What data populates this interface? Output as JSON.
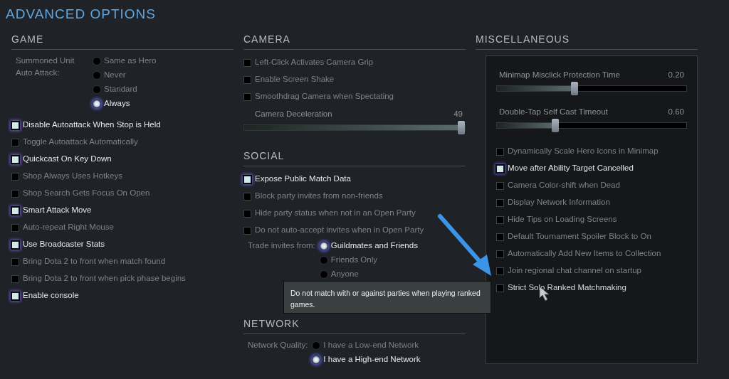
{
  "title": "ADVANCED OPTIONS",
  "columns": [
    {
      "sections": [
        {
          "heading": "GAME",
          "boxed": false,
          "items": [
            {
              "kind": "radio_group",
              "label": "Summoned Unit Auto Attack:",
              "options": [
                {
                  "label": "Same as Hero",
                  "selected": false
                },
                {
                  "label": "Never",
                  "selected": false
                },
                {
                  "label": "Standard",
                  "selected": false
                },
                {
                  "label": "Always",
                  "selected": true
                }
              ]
            },
            {
              "kind": "checkbox",
              "label": "Disable Autoattack When Stop is Held",
              "checked": true
            },
            {
              "kind": "checkbox",
              "label": "Toggle Autoattack Automatically",
              "checked": false
            },
            {
              "kind": "checkbox",
              "label": "Quickcast On Key Down",
              "checked": true
            },
            {
              "kind": "checkbox",
              "label": "Shop Always Uses Hotkeys",
              "checked": false
            },
            {
              "kind": "checkbox",
              "label": "Shop Search Gets Focus On Open",
              "checked": false
            },
            {
              "kind": "checkbox",
              "label": "Smart Attack Move",
              "checked": true
            },
            {
              "kind": "checkbox",
              "label": "Auto-repeat Right Mouse",
              "checked": false
            },
            {
              "kind": "checkbox",
              "label": "Use Broadcaster Stats",
              "checked": true
            },
            {
              "kind": "checkbox",
              "label": "Bring Dota 2 to front when match found",
              "checked": false
            },
            {
              "kind": "checkbox",
              "label": "Bring Dota 2 to front when pick phase begins",
              "checked": false
            },
            {
              "kind": "checkbox",
              "label": "Enable console",
              "checked": true
            }
          ]
        }
      ]
    },
    {
      "sections": [
        {
          "heading": "CAMERA",
          "boxed": false,
          "items": [
            {
              "kind": "checkbox",
              "label": "Left-Click Activates Camera Grip",
              "checked": false
            },
            {
              "kind": "checkbox",
              "label": "Enable Screen Shake",
              "checked": false
            },
            {
              "kind": "checkbox",
              "label": "Smoothdrag Camera when Spectating",
              "checked": false
            },
            {
              "kind": "slider",
              "label": "Camera Deceleration",
              "reading": "49",
              "level": 0.98
            }
          ]
        },
        {
          "heading": "SOCIAL",
          "boxed": false,
          "items": [
            {
              "kind": "checkbox",
              "label": "Expose Public Match Data",
              "checked": true
            },
            {
              "kind": "checkbox",
              "label": "Block party invites from non-friends",
              "checked": false
            },
            {
              "kind": "checkbox",
              "label": "Hide party status when not in an Open Party",
              "checked": false
            },
            {
              "kind": "checkbox",
              "label": "Do not auto-accept invites when in Open Party",
              "checked": false
            },
            {
              "kind": "radio_group",
              "label": "Trade invites from:",
              "options": [
                {
                  "label": "Guildmates and Friends",
                  "selected": true
                },
                {
                  "label": "Friends Only",
                  "selected": false
                },
                {
                  "label": "Anyone",
                  "selected": false
                }
              ]
            }
          ]
        },
        {
          "heading": "NETWORK",
          "boxed": false,
          "items": [
            {
              "kind": "radio_group",
              "label": "Network Quality:",
              "options": [
                {
                  "label": "I have a Low-end Network",
                  "selected": false
                },
                {
                  "label": "I have a High-end Network",
                  "selected": true
                }
              ]
            }
          ]
        }
      ]
    },
    {
      "sections": [
        {
          "heading": "MISCELLANEOUS",
          "boxed": true,
          "items": [
            {
              "kind": "slider",
              "label": "Minimap Misclick Protection Time",
              "reading": "0.20",
              "level": 0.41
            },
            {
              "kind": "slider",
              "label": "Double-Tap Self Cast Timeout",
              "reading": "0.60",
              "level": 0.31
            },
            {
              "kind": "checkbox",
              "label": "Dynamically Scale Hero Icons in Minimap",
              "checked": false,
              "hovered": false
            },
            {
              "kind": "checkbox",
              "label": "Move after Ability Target Cancelled",
              "checked": true,
              "hovered": false
            },
            {
              "kind": "checkbox",
              "label": "Camera Color-shift when Dead",
              "checked": false,
              "hovered": false
            },
            {
              "kind": "checkbox",
              "label": "Display Network Information",
              "checked": false,
              "hovered": false
            },
            {
              "kind": "checkbox",
              "label": "Hide Tips on Loading Screens",
              "checked": false,
              "hovered": false
            },
            {
              "kind": "checkbox",
              "label": "Default Tournament Spoiler Block to On",
              "checked": false,
              "hovered": false
            },
            {
              "kind": "checkbox",
              "label": "Automatically Add New Items to Collection",
              "checked": false,
              "hovered": false
            },
            {
              "kind": "checkbox",
              "label": "Join regional chat channel on startup",
              "checked": false,
              "hovered": false
            },
            {
              "kind": "checkbox",
              "label": "Strict Solo Ranked Matchmaking",
              "checked": false,
              "hovered": true
            }
          ]
        }
      ]
    }
  ],
  "tooltip": {
    "text": "Do not match with or against parties when playing ranked games."
  }
}
